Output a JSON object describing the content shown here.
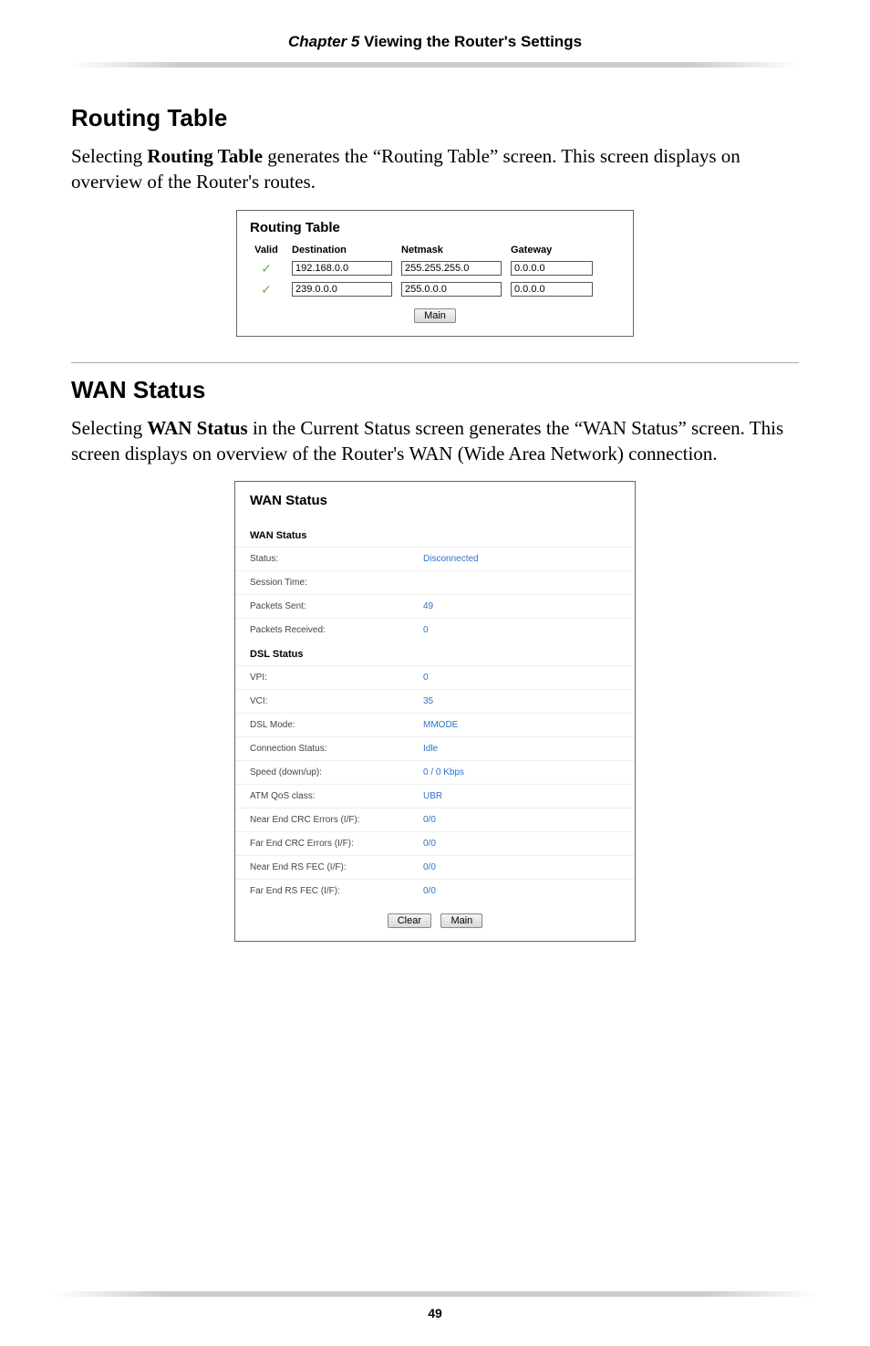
{
  "header": {
    "chapter_label": "Chapter 5",
    "chapter_title": "  Viewing the Router's Settings"
  },
  "section1": {
    "heading": "Routing Table",
    "para_parts": {
      "p1": "Selecting ",
      "p2": "Routing Table",
      "p3": " generates the “Routing Table” screen. This screen displays on overview of the Router's routes."
    }
  },
  "routing_fig": {
    "title": "Routing Table",
    "columns": {
      "valid": "Valid",
      "destination": "Destination",
      "netmask": "Netmask",
      "gateway": "Gateway"
    },
    "rows": [
      {
        "destination": "192.168.0.0",
        "netmask": "255.255.255.0",
        "gateway": "0.0.0.0"
      },
      {
        "destination": "239.0.0.0",
        "netmask": "255.0.0.0",
        "gateway": "0.0.0.0"
      }
    ],
    "main_btn": "Main"
  },
  "section2": {
    "heading": "WAN Status",
    "para_parts": {
      "p1": "Selecting ",
      "p2": "WAN Status",
      "p3": " in the Current Status screen generates the “",
      "p4": "WAN",
      "p5": " Status” screen. This screen displays on overview of the Router's ",
      "p6": "WAN",
      "p7": " (Wide Area Network) connection."
    }
  },
  "wan_fig": {
    "title": "WAN Status",
    "group1_head": "WAN Status",
    "group1_rows": [
      {
        "label": "Status:",
        "value": "Disconnected"
      },
      {
        "label": "Session Time:",
        "value": ""
      },
      {
        "label": "Packets Sent:",
        "value": "49"
      },
      {
        "label": "Packets Received:",
        "value": "0"
      }
    ],
    "group2_head": "DSL Status",
    "group2_rows": [
      {
        "label": "VPI:",
        "value": "0"
      },
      {
        "label": "VCI:",
        "value": "35"
      },
      {
        "label": "DSL Mode:",
        "value": "MMODE"
      },
      {
        "label": "Connection Status:",
        "value": "Idle"
      },
      {
        "label": "Speed (down/up):",
        "value": "0 / 0 Kbps"
      },
      {
        "label": "ATM QoS class:",
        "value": "UBR"
      },
      {
        "label": "Near End CRC Errors (I/F):",
        "value": "0/0"
      },
      {
        "label": "Far End CRC Errors (I/F):",
        "value": "0/0"
      },
      {
        "label": "Near End RS FEC (I/F):",
        "value": "0/0"
      },
      {
        "label": "Far End RS FEC (I/F):",
        "value": "0/0"
      }
    ],
    "clear_btn": "Clear",
    "main_btn": "Main"
  },
  "footer": {
    "page_number": "49"
  }
}
